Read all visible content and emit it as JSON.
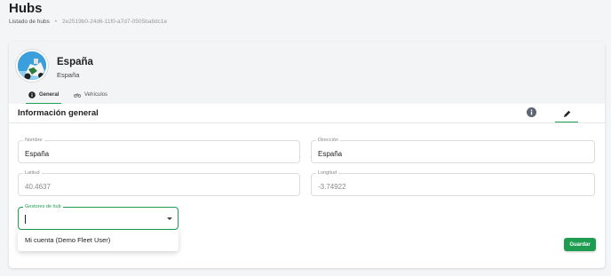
{
  "page": {
    "title": "Hubs"
  },
  "breadcrumb": {
    "parent": "Listado de hubs",
    "separator": "•",
    "current": "2e2519b0-24d6-11f0-a7d7-0505ba8dc1e"
  },
  "hub": {
    "name": "España",
    "subtitle": "España",
    "avatar_icon": "vehicle-photo"
  },
  "tabs": [
    {
      "label": "General",
      "icon": "info-icon",
      "active": true
    },
    {
      "label": "Vehículos",
      "icon": "bicycle-icon",
      "active": false
    }
  ],
  "section": {
    "title": "Información general",
    "info_icon": "info-icon",
    "edit_icon": "pencil-icon"
  },
  "form": {
    "nombre": {
      "label": "Nombre",
      "value": "España"
    },
    "direccion": {
      "label": "Dirección",
      "value": "España"
    },
    "latitud": {
      "label": "Latitud",
      "value": "40.4637"
    },
    "longitud": {
      "label": "Longitud",
      "value": "-3.74922"
    },
    "gestores": {
      "label": "Gestores de hub",
      "value": ""
    }
  },
  "dropdown": {
    "options": [
      "Mi cuenta (Demo Fleet User)"
    ]
  },
  "actions": {
    "save_label": "Guardar"
  },
  "colors": {
    "accent": "#1e9c50",
    "header_bg": "#f3f4f6",
    "page_bg": "#f4f5f7"
  }
}
